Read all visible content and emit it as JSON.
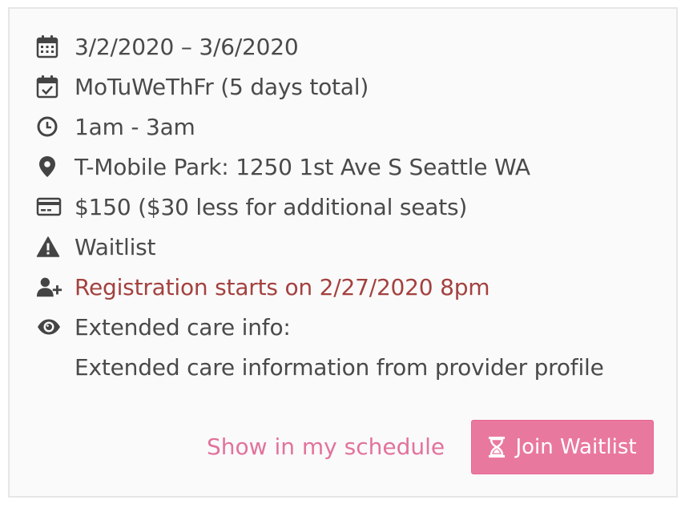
{
  "details": {
    "dates": "3/2/2020 – 3/6/2020",
    "days": "MoTuWeThFr (5 days total)",
    "time": "1am - 3am",
    "location": "T-Mobile Park: 1250 1st Ave S Seattle WA",
    "price": "$150 ($30 less for additional seats)",
    "status": "Waitlist",
    "registration": "Registration starts on 2/27/2020 8pm",
    "extended_care_label": "Extended care info:",
    "extended_care_text": "Extended care information from provider profile"
  },
  "actions": {
    "show_schedule": "Show in my schedule",
    "join_waitlist": "Join Waitlist"
  },
  "icons": {
    "dates": "calendar-icon",
    "days": "calendar-check-icon",
    "time": "clock-icon",
    "location": "map-marker-icon",
    "price": "credit-card-icon",
    "status": "warning-icon",
    "registration": "user-plus-icon",
    "extended_care": "eye-icon",
    "join": "hourglass-icon"
  },
  "colors": {
    "accent": "#e9789f",
    "link": "#e2739b",
    "alert": "#a3413f"
  }
}
